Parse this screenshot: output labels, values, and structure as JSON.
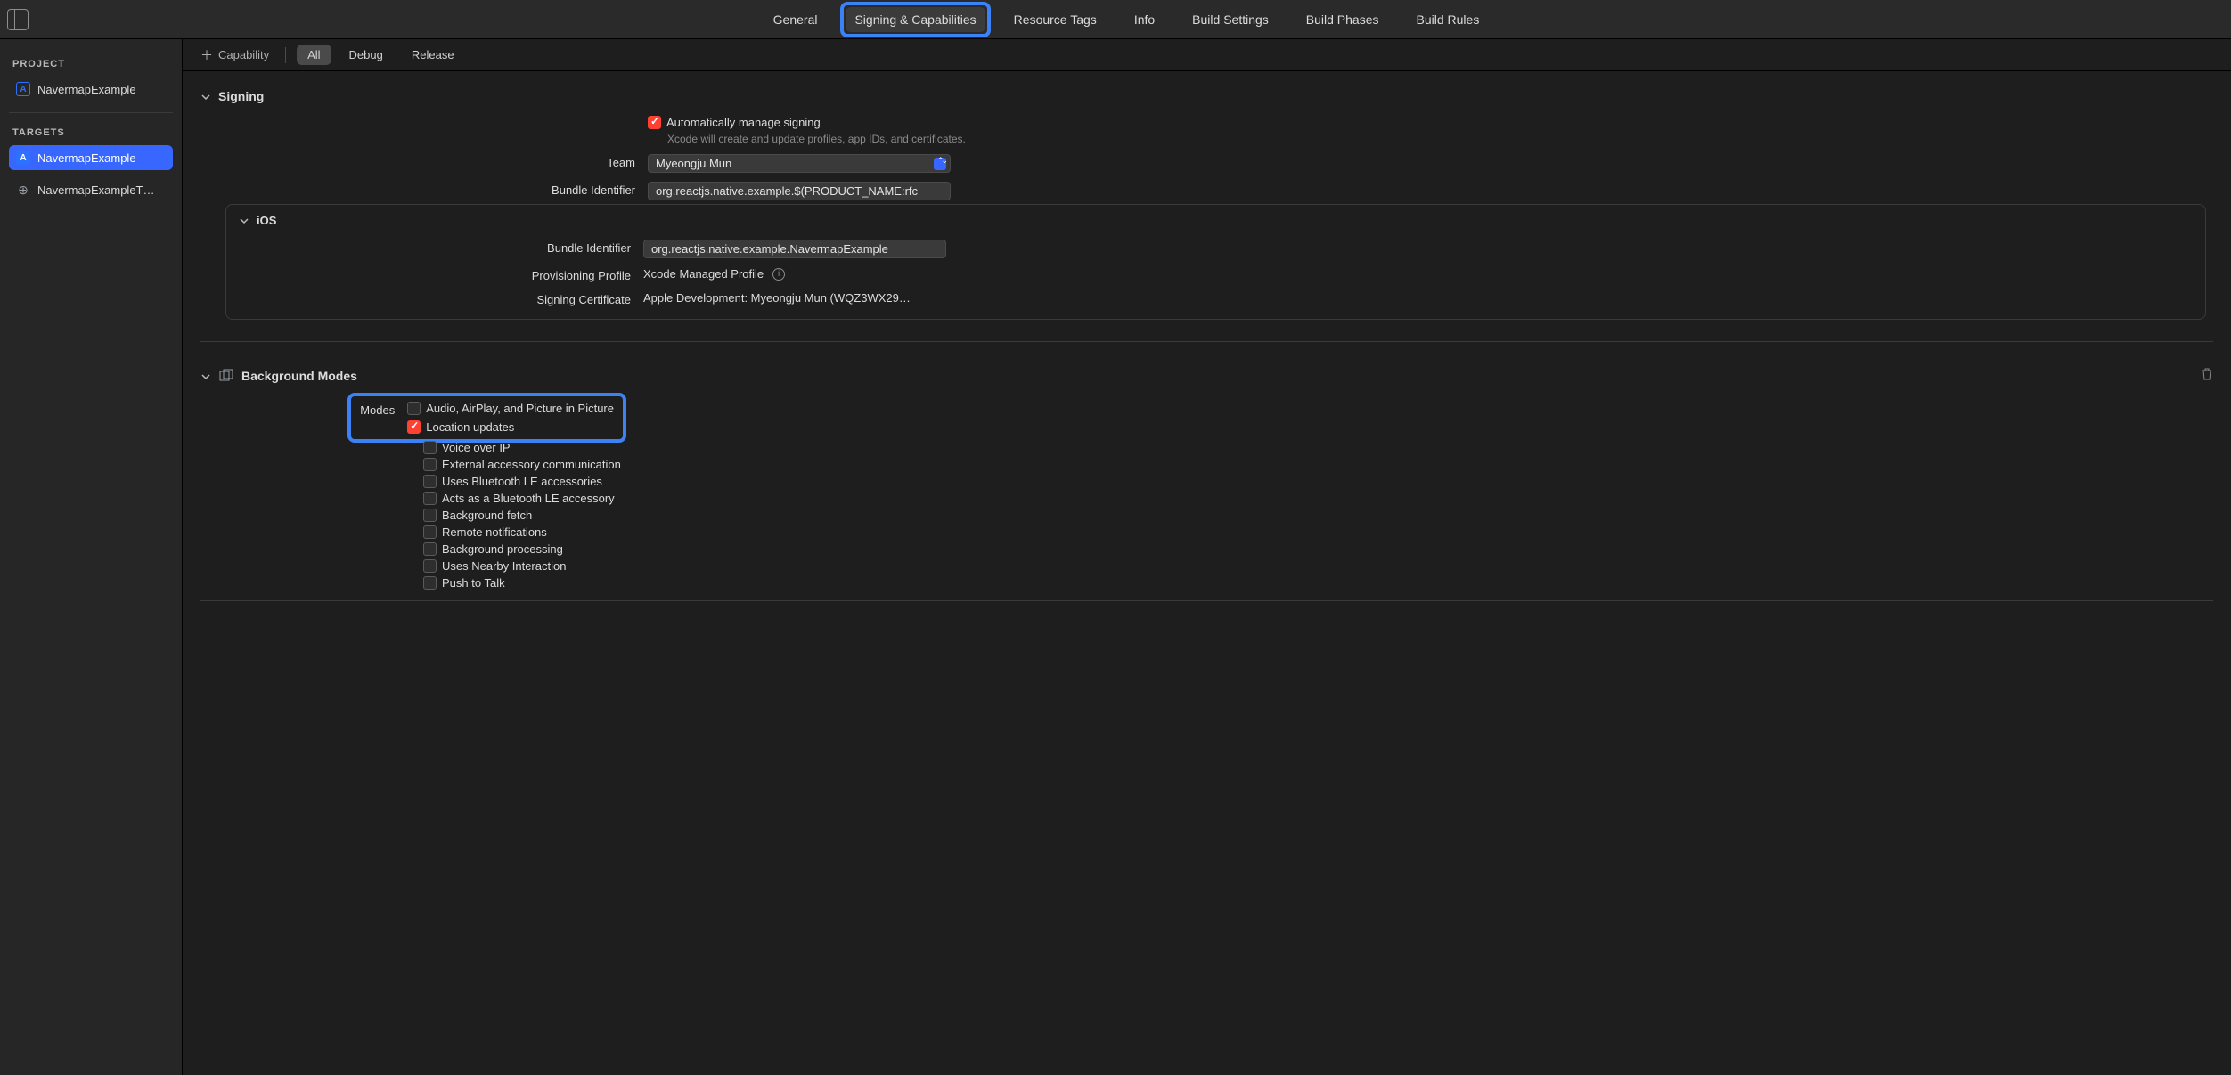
{
  "tabs": {
    "general": "General",
    "signing": "Signing & Capabilities",
    "resource": "Resource Tags",
    "info": "Info",
    "settings": "Build Settings",
    "phases": "Build Phases",
    "rules": "Build Rules"
  },
  "sidebar": {
    "project_header": "PROJECT",
    "project_name": "NavermapExample",
    "targets_header": "TARGETS",
    "target1": "NavermapExample",
    "target2": "NavermapExampleT…"
  },
  "subbar": {
    "capability": "Capability",
    "all": "All",
    "debug": "Debug",
    "release": "Release"
  },
  "signing": {
    "title": "Signing",
    "auto_label": "Automatically manage signing",
    "auto_hint": "Xcode will create and update profiles, app IDs, and certificates.",
    "team_label": "Team",
    "team_value": "Myeongju Mun",
    "bundle_label": "Bundle Identifier",
    "bundle_value": "org.reactjs.native.example.$(PRODUCT_NAME:rfc",
    "ios": {
      "title": "iOS",
      "bundle_label": "Bundle Identifier",
      "bundle_value": "org.reactjs.native.example.NavermapExample",
      "prov_label": "Provisioning Profile",
      "prov_value": "Xcode Managed Profile",
      "cert_label": "Signing Certificate",
      "cert_value": "Apple Development: Myeongju Mun (WQZ3WX29…"
    }
  },
  "bg": {
    "title": "Background Modes",
    "modes_label": "Modes",
    "items": {
      "audio": "Audio, AirPlay, and Picture in Picture",
      "location": "Location updates",
      "voip": "Voice over IP",
      "ext": "External accessory communication",
      "ble_use": "Uses Bluetooth LE accessories",
      "ble_act": "Acts as a Bluetooth LE accessory",
      "fetch": "Background fetch",
      "remote": "Remote notifications",
      "proc": "Background processing",
      "nearby": "Uses Nearby Interaction",
      "ptt": "Push to Talk"
    }
  }
}
